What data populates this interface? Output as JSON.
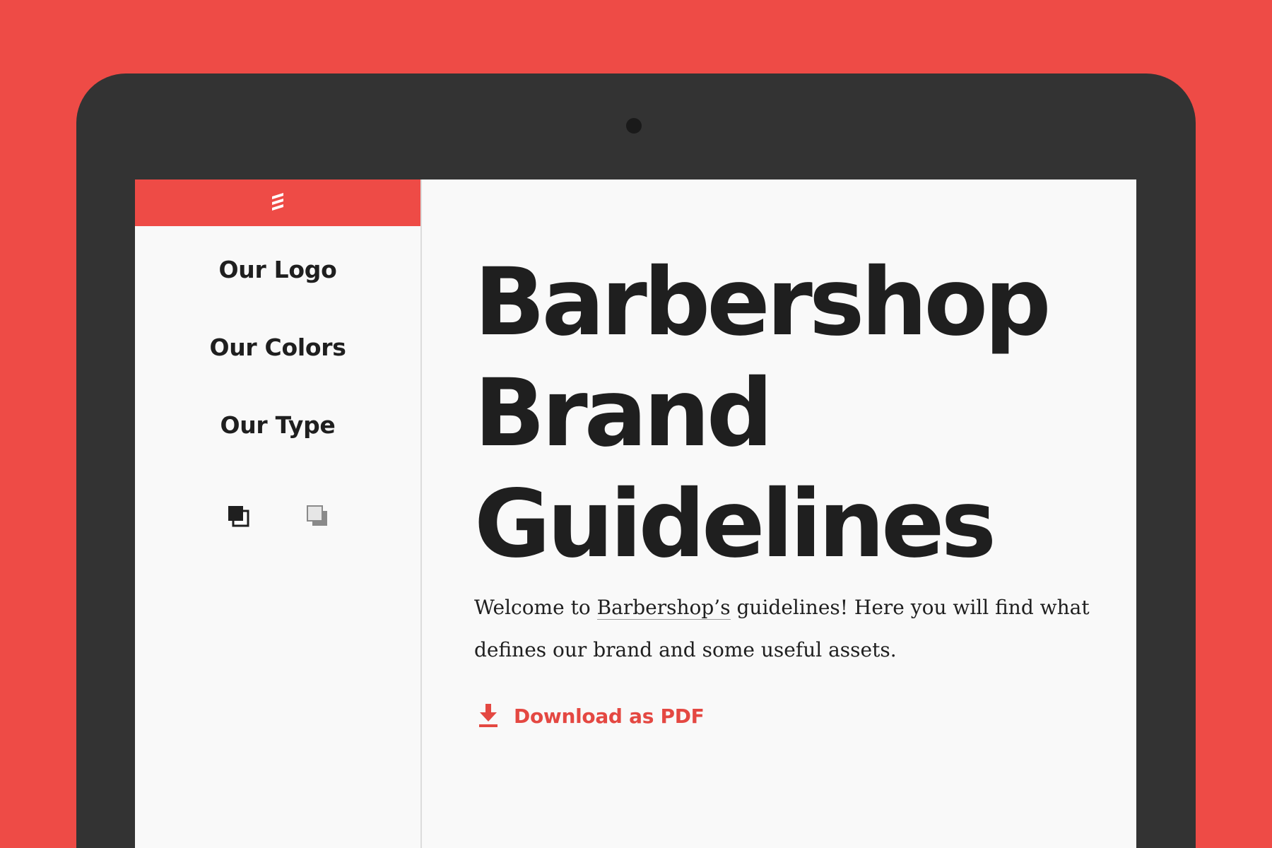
{
  "colors": {
    "background": "#ee4b46",
    "bezel": "#333333",
    "screen": "#f9f9f9",
    "accent": "#e44842",
    "text": "#1f1f1f"
  },
  "sidebar": {
    "logo_icon": "barber-pole-icon",
    "items": [
      {
        "label": "Our Logo"
      },
      {
        "label": "Our Colors"
      },
      {
        "label": "Our Type"
      }
    ],
    "theme_toggles": [
      {
        "icon": "dark-theme-icon"
      },
      {
        "icon": "light-theme-icon"
      }
    ]
  },
  "main": {
    "title_lines": [
      "Barbershop",
      "Brand",
      "Guidelines"
    ],
    "intro": {
      "before_link": "Welcome to ",
      "link": "Barbershop’s",
      "after_link": " guidelines! Here you will find what defines our brand and some useful assets."
    },
    "download": {
      "icon": "download-icon",
      "label": "Download as PDF"
    }
  }
}
